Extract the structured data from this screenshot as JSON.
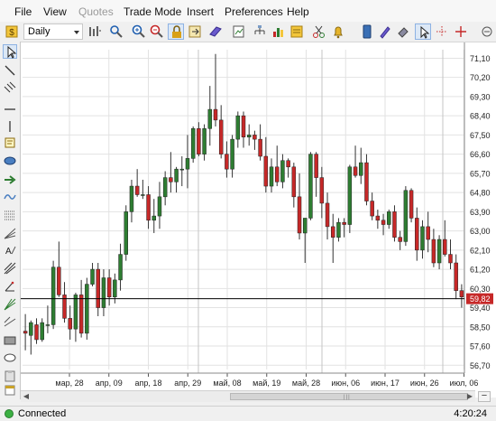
{
  "menu": [
    "File",
    "View",
    "Quotes",
    "Trade Mode",
    "Insert",
    "Preferences",
    "Help"
  ],
  "menu_disabled": [
    "Quotes"
  ],
  "toolbar": {
    "timeframe": "Daily",
    "buttons": [
      "chart-type-icon",
      "zoom-icon",
      "zoom-in-icon",
      "zoom-out-icon",
      "lock-icon",
      "autoscroll-icon",
      "tag-icon",
      "template-icon",
      "objects-tree-icon",
      "indicators-icon",
      "scissors-icon",
      "alert-bell-icon",
      "trading-panel-icon",
      "pen-icon",
      "eraser-icon",
      "cursor-icon",
      "crosshair-icon",
      "dots-cross-icon",
      "plus-cross-icon"
    ]
  },
  "drawing_tools": [
    "cursor-icon",
    "line-icon",
    "parallel-lines-icon",
    "horizontal-line-icon",
    "vertical-line-icon",
    "note-icon",
    "ellipse-icon",
    "arrow-icon",
    "wave-icon",
    "fibonacci-icon",
    "text-icon",
    "pitchfork-icon",
    "angle-icon",
    "fan-icon",
    "rectangle-icon",
    "oval-icon",
    "clipboard-icon",
    "calendar-icon"
  ],
  "chart_data": {
    "type": "candlestick",
    "timeframe": "Daily",
    "ylim": [
      56.5,
      71.5
    ],
    "y_ticks": [
      "71,10",
      "70,20",
      "69,30",
      "68,40",
      "67,50",
      "66,60",
      "65,70",
      "64,80",
      "63,90",
      "63,00",
      "62,10",
      "61,20",
      "60,30",
      "59,40",
      "58,50",
      "57,60",
      "56,70"
    ],
    "x_ticks": [
      "мар, 28",
      "апр, 09",
      "апр, 18",
      "апр, 29",
      "май, 08",
      "май, 19",
      "май, 28",
      "июн, 06",
      "июн, 17",
      "июн, 26",
      "июл, 06"
    ],
    "current_price": "59,82",
    "colors": {
      "up": "#2e7d32",
      "down": "#c62828",
      "grid": "#e2e2e2",
      "price_line": "#000000",
      "price_label_bg": "#c62828"
    },
    "candles": [
      [
        58.3,
        59.1,
        57.4,
        58.2
      ],
      [
        58.1,
        58.8,
        57.2,
        58.7
      ],
      [
        58.6,
        58.9,
        57.7,
        57.9
      ],
      [
        57.9,
        58.9,
        57.8,
        58.7
      ],
      [
        58.6,
        59.5,
        58.2,
        58.6
      ],
      [
        58.6,
        61.6,
        58.4,
        61.3
      ],
      [
        61.3,
        62.5,
        59.9,
        60.0
      ],
      [
        60.0,
        60.6,
        58.7,
        58.9
      ],
      [
        58.9,
        59.5,
        57.9,
        58.4
      ],
      [
        58.4,
        60.1,
        57.8,
        60.0
      ],
      [
        60.0,
        60.7,
        58.0,
        58.2
      ],
      [
        58.2,
        60.8,
        57.9,
        60.5
      ],
      [
        60.5,
        61.5,
        60.4,
        61.2
      ],
      [
        61.2,
        61.5,
        59.0,
        59.4
      ],
      [
        59.4,
        61.2,
        59.0,
        60.8
      ],
      [
        60.8,
        61.2,
        59.5,
        59.9
      ],
      [
        59.9,
        61.0,
        59.6,
        60.7
      ],
      [
        60.7,
        62.4,
        60.2,
        61.9
      ],
      [
        61.9,
        64.2,
        61.6,
        63.9
      ],
      [
        63.9,
        65.4,
        63.4,
        65.1
      ],
      [
        65.1,
        65.9,
        64.6,
        64.7
      ],
      [
        64.7,
        65.4,
        64.5,
        64.7
      ],
      [
        64.7,
        65.1,
        63.1,
        63.5
      ],
      [
        63.5,
        64.5,
        62.9,
        63.7
      ],
      [
        63.7,
        65.3,
        63.1,
        64.6
      ],
      [
        64.6,
        65.8,
        64.2,
        65.5
      ],
      [
        65.5,
        66.7,
        64.8,
        65.3
      ],
      [
        65.3,
        66.0,
        64.8,
        65.9
      ],
      [
        65.9,
        66.5,
        65.1,
        65.9
      ],
      [
        65.9,
        67.5,
        65.0,
        66.4
      ],
      [
        66.4,
        67.9,
        66.2,
        67.8
      ],
      [
        67.8,
        68.1,
        66.5,
        66.6
      ],
      [
        66.6,
        68.0,
        66.3,
        67.8
      ],
      [
        67.8,
        69.8,
        67.0,
        68.7
      ],
      [
        68.7,
        71.3,
        67.9,
        68.2
      ],
      [
        68.2,
        68.9,
        66.4,
        66.6
      ],
      [
        66.6,
        67.2,
        65.5,
        65.9
      ],
      [
        65.9,
        67.5,
        65.5,
        67.3
      ],
      [
        67.3,
        68.6,
        66.9,
        68.4
      ],
      [
        68.4,
        68.6,
        66.9,
        67.4
      ],
      [
        67.4,
        68.0,
        67.0,
        67.5
      ],
      [
        67.5,
        67.7,
        66.8,
        67.3
      ],
      [
        67.3,
        68.0,
        66.3,
        66.5
      ],
      [
        66.5,
        67.4,
        64.8,
        65.1
      ],
      [
        65.1,
        66.4,
        64.8,
        66.0
      ],
      [
        66.0,
        67.0,
        65.1,
        65.3
      ],
      [
        65.3,
        66.6,
        65.0,
        66.3
      ],
      [
        66.3,
        66.4,
        65.5,
        66.0
      ],
      [
        66.0,
        66.2,
        64.1,
        64.6
      ],
      [
        64.6,
        65.7,
        62.6,
        62.9
      ],
      [
        62.9,
        63.4,
        61.5,
        63.6
      ],
      [
        63.6,
        66.7,
        63.5,
        66.6
      ],
      [
        66.6,
        66.7,
        64.6,
        65.5
      ],
      [
        65.5,
        66.0,
        63.6,
        64.3
      ],
      [
        64.3,
        64.8,
        62.6,
        63.2
      ],
      [
        63.2,
        63.8,
        61.5,
        62.7
      ],
      [
        62.7,
        63.6,
        62.5,
        63.4
      ],
      [
        63.4,
        63.6,
        62.7,
        63.3
      ],
      [
        63.3,
        66.1,
        62.9,
        66.0
      ],
      [
        66.0,
        67.0,
        65.5,
        65.6
      ],
      [
        65.6,
        66.9,
        65.2,
        66.2
      ],
      [
        66.2,
        66.6,
        64.2,
        64.4
      ],
      [
        64.4,
        64.8,
        63.5,
        63.7
      ],
      [
        63.7,
        64.0,
        63.1,
        63.5
      ],
      [
        63.5,
        63.8,
        62.8,
        63.3
      ],
      [
        63.3,
        64.0,
        63.1,
        63.9
      ],
      [
        63.9,
        64.2,
        62.5,
        62.7
      ],
      [
        62.7,
        63.0,
        62.1,
        62.5
      ],
      [
        62.5,
        65.1,
        62.3,
        64.9
      ],
      [
        64.9,
        65.0,
        63.4,
        63.6
      ],
      [
        63.6,
        64.1,
        61.6,
        62.1
      ],
      [
        62.1,
        63.5,
        61.7,
        63.2
      ],
      [
        63.2,
        63.9,
        62.0,
        62.6
      ],
      [
        62.6,
        63.1,
        61.3,
        61.5
      ],
      [
        61.5,
        62.8,
        61.2,
        62.6
      ],
      [
        62.6,
        63.5,
        61.8,
        61.9
      ],
      [
        61.9,
        62.6,
        61.2,
        61.5
      ],
      [
        61.5,
        61.9,
        59.8,
        60.2
      ],
      [
        60.2,
        60.5,
        59.4,
        59.9
      ]
    ]
  },
  "status": {
    "connection": "Connected",
    "time": "4:20:24"
  }
}
